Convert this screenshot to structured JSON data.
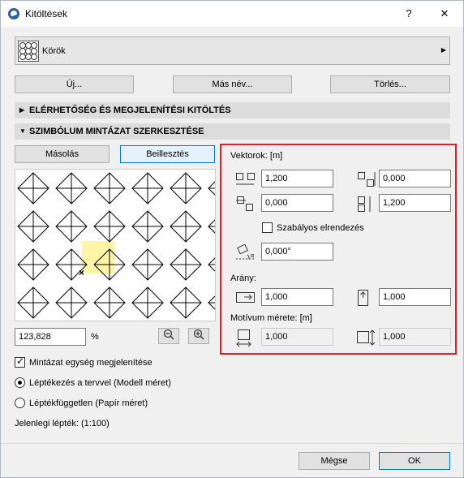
{
  "window": {
    "title": "Kitöltések",
    "help_label": "?",
    "close_label": "✕"
  },
  "fill_selector": {
    "value": "Körök",
    "arrow": "▶"
  },
  "buttons": {
    "new": "Új...",
    "rename": "Más név...",
    "delete": "Törlés..."
  },
  "sections": {
    "availability": {
      "label": "ELÉRHETŐSÉG ÉS MEGJELENÍTÉSI KITÖLTÉS",
      "state": "collapsed"
    },
    "symbol_edit": {
      "label": "SZIMBÓLUM MINTÁZAT SZERKESZTÉSE",
      "state": "expanded"
    }
  },
  "edit_buttons": {
    "copy": "Másolás",
    "paste": "Beillesztés"
  },
  "zoom": {
    "value": "123,828",
    "unit": "%"
  },
  "vectors": {
    "title": "Vektorok: [m]",
    "x1": "1,200",
    "y1": "0,000",
    "x2": "0,000",
    "y2": "1,200",
    "regular_label": "Szabályos elrendezés",
    "angle": "0,000°"
  },
  "ratio": {
    "title": "Arány:",
    "x": "1,000",
    "y": "1,000"
  },
  "motif": {
    "title": "Motívum mérete: [m]",
    "width": "1,000",
    "height": "1,000"
  },
  "options": {
    "show_unit": "Mintázat egység megjelenítése",
    "scale_with_plan": "Léptékezés a tervvel (Modell méret)",
    "scale_independent": "Léptékfüggetlen (Papír méret)"
  },
  "current_scale": "Jelenlegi lépték: (1:100)",
  "footer": {
    "cancel": "Mégse",
    "ok": "OK"
  }
}
